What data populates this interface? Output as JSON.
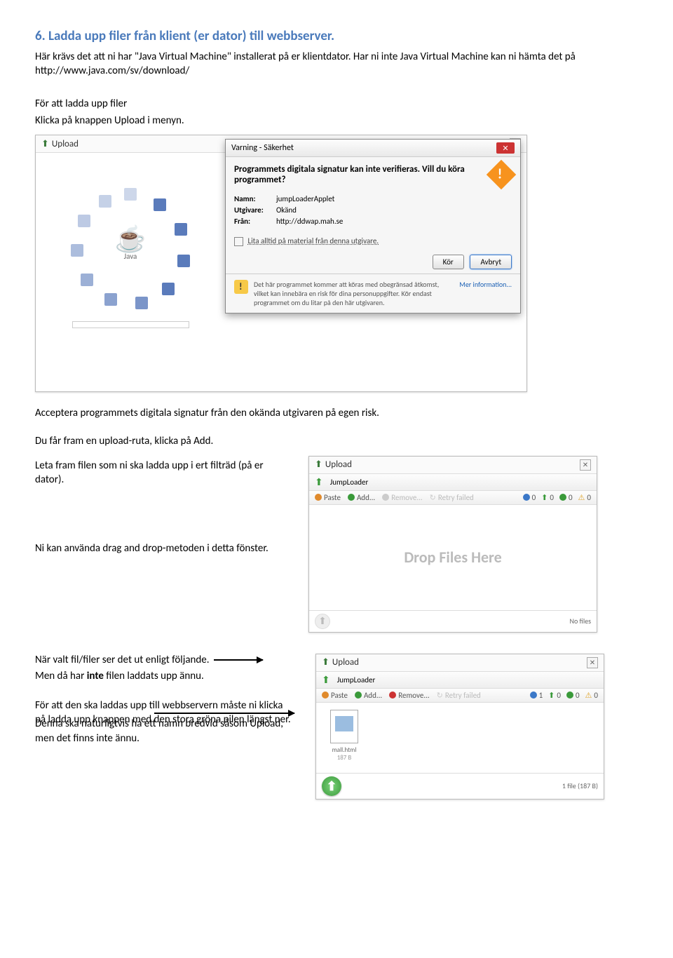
{
  "heading": "6. Ladda upp filer från klient (er dator) till webbserver.",
  "intro1": "Här krävs det att ni har \"Java Virtual Machine\" installerat på er klientdator. Har ni inte Java Virtual Machine kan ni hämta det på http://www.java.com/sv/download/",
  "intro2": "För att ladda upp filer",
  "intro3": "Klicka på knappen Upload i menyn.",
  "upload_dialog": {
    "title": "Upload"
  },
  "java_logo_caption": "Java",
  "security": {
    "window_title": "Varning - Säkerhet",
    "headline": "Programmets digitala signatur kan inte verifieras. Vill du köra programmet?",
    "name_label": "Namn:",
    "name_val": "jumpLoaderApplet",
    "publisher_label": "Utgivare:",
    "publisher_val": "Okänd",
    "from_label": "Från:",
    "from_val": "http://ddwap.mah.se",
    "always_trust": "Lita alltid på material från denna utgivare.",
    "run": "Kör",
    "cancel": "Avbryt",
    "footnote": "Det här programmet kommer att köras med obegränsad åtkomst, vilket kan innebära en risk för dina personuppgifter. Kör endast programmet om du litar på den här utgivaren.",
    "more_info": "Mer information..."
  },
  "para_accept": "Acceptera programmets digitala signatur från den okända utgivaren på egen risk.",
  "para_add": "Du får fram en upload-ruta, klicka på Add.",
  "para_leta": "Leta fram filen som ni ska ladda upp i ert filträd (på er dator).",
  "para_drag": "Ni kan använda drag and drop-metoden i detta fönster.",
  "jumploader1": {
    "upload_title": "Upload",
    "name": "JumpLoader",
    "paste": "Paste",
    "add": "Add...",
    "remove": "Remove...",
    "retry": "Retry failed",
    "drop_text": "Drop Files Here",
    "status": "No files"
  },
  "para_when_selected": "När valt fil/filer ser det ut enligt följande.",
  "para_not_uploaded": "Men då har inte filen laddats upp ännu.",
  "bold_inte": "inte",
  "para_load1": "För att den ska laddas upp till webbservern måste ni klicka på ladda upp knappen med den stora gröna pilen längst ner.",
  "para_load2": "Denna ska naturligtvis ha ett namn bredvid såsom Upload, men det finns inte ännu.",
  "jumploader2": {
    "upload_title": "Upload",
    "name": "JumpLoader",
    "paste": "Paste",
    "add": "Add...",
    "remove": "Remove...",
    "retry": "Retry failed",
    "file_name": "mall.html",
    "file_size": "187 B",
    "status": "1 file (187 B)",
    "count1": "1",
    "zero": "0"
  }
}
